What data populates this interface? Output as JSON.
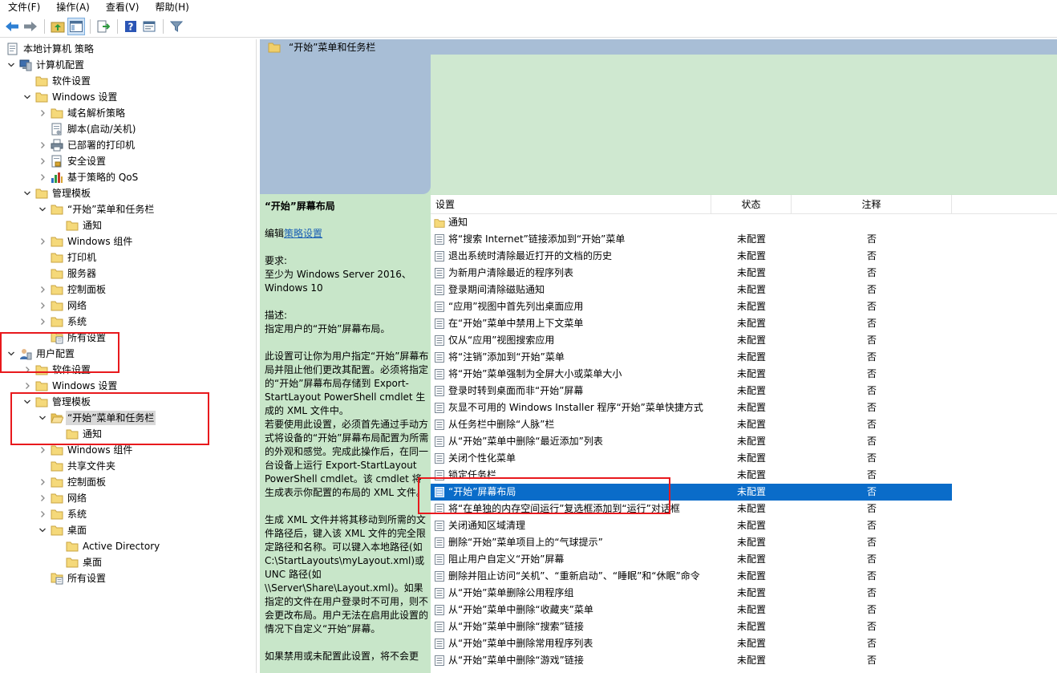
{
  "menu": [
    "文件(F)",
    "操作(A)",
    "查看(V)",
    "帮助(H)"
  ],
  "tree": [
    {
      "label": "本地计算机 策略",
      "level": 0,
      "exp": "",
      "icon": "policy-doc-icon"
    },
    {
      "label": "计算机配置",
      "level": 0,
      "exp": "open",
      "icon": "computer-icon"
    },
    {
      "label": "软件设置",
      "level": 1,
      "exp": "",
      "icon": "folder-icon"
    },
    {
      "label": "Windows 设置",
      "level": 1,
      "exp": "open",
      "icon": "folder-icon"
    },
    {
      "label": "域名解析策略",
      "level": 2,
      "exp": "closed",
      "icon": "folder-icon"
    },
    {
      "label": "脚本(启动/关机)",
      "level": 2,
      "exp": "",
      "icon": "script-icon"
    },
    {
      "label": "已部署的打印机",
      "level": 2,
      "exp": "closed",
      "icon": "printer-icon"
    },
    {
      "label": "安全设置",
      "level": 2,
      "exp": "closed",
      "icon": "security-icon"
    },
    {
      "label": "基于策略的 QoS",
      "level": 2,
      "exp": "closed",
      "icon": "qos-chart-icon"
    },
    {
      "label": "管理模板",
      "level": 1,
      "exp": "open",
      "icon": "folder-icon"
    },
    {
      "label": "“开始”菜单和任务栏",
      "level": 2,
      "exp": "open",
      "icon": "folder-icon"
    },
    {
      "label": "通知",
      "level": 3,
      "exp": "",
      "icon": "folder-icon"
    },
    {
      "label": "Windows 组件",
      "level": 2,
      "exp": "closed",
      "icon": "folder-icon"
    },
    {
      "label": "打印机",
      "level": 2,
      "exp": "",
      "icon": "folder-icon"
    },
    {
      "label": "服务器",
      "level": 2,
      "exp": "",
      "icon": "folder-icon"
    },
    {
      "label": "控制面板",
      "level": 2,
      "exp": "closed",
      "icon": "folder-icon"
    },
    {
      "label": "网络",
      "level": 2,
      "exp": "closed",
      "icon": "folder-icon"
    },
    {
      "label": "系统",
      "level": 2,
      "exp": "closed",
      "icon": "folder-icon"
    },
    {
      "label": "所有设置",
      "level": 2,
      "exp": "",
      "icon": "all-settings-icon"
    },
    {
      "label": "用户配置",
      "level": 0,
      "exp": "open",
      "icon": "user-icon"
    },
    {
      "label": "软件设置",
      "level": 1,
      "exp": "closed",
      "icon": "folder-icon"
    },
    {
      "label": "Windows 设置",
      "level": 1,
      "exp": "closed",
      "icon": "folder-icon"
    },
    {
      "label": "管理模板",
      "level": 1,
      "exp": "open",
      "icon": "folder-icon"
    },
    {
      "label": "“开始”菜单和任务栏",
      "level": 2,
      "exp": "open",
      "icon": "folder-open-icon",
      "selected": true
    },
    {
      "label": "通知",
      "level": 3,
      "exp": "",
      "icon": "folder-icon"
    },
    {
      "label": "Windows 组件",
      "level": 2,
      "exp": "closed",
      "icon": "folder-icon"
    },
    {
      "label": "共享文件夹",
      "level": 2,
      "exp": "",
      "icon": "folder-icon"
    },
    {
      "label": "控制面板",
      "level": 2,
      "exp": "closed",
      "icon": "folder-icon"
    },
    {
      "label": "网络",
      "level": 2,
      "exp": "closed",
      "icon": "folder-icon"
    },
    {
      "label": "系统",
      "level": 2,
      "exp": "closed",
      "icon": "folder-icon"
    },
    {
      "label": "桌面",
      "level": 2,
      "exp": "open",
      "icon": "folder-icon"
    },
    {
      "label": "Active Directory",
      "level": 3,
      "exp": "",
      "icon": "folder-icon"
    },
    {
      "label": "桌面",
      "level": 3,
      "exp": "",
      "icon": "folder-icon"
    },
    {
      "label": "所有设置",
      "level": 2,
      "exp": "",
      "icon": "all-settings-icon"
    }
  ],
  "right": {
    "header_title": "“开始”菜单和任务栏",
    "desc": {
      "title": "“开始”屏幕布局",
      "edit_prefix": "编辑",
      "edit_link": "策略设置",
      "req_label": "要求:",
      "req_text": "至少为 Windows Server 2016、Windows 10",
      "desc_label": "描述:",
      "desc_text": "指定用户的“开始”屏幕布局。",
      "p1": "此设置可让你为用户指定“开始”屏幕布局并阻止他们更改其配置。必须将指定的“开始”屏幕布局存储到 Export-StartLayout PowerShell cmdlet 生成的 XML 文件中。",
      "p2": "若要使用此设置，必须首先通过手动方式将设备的“开始”屏幕布局配置为所需的外观和感觉。完成此操作后，在同一台设备上运行 Export-StartLayout PowerShell cmdlet。该 cmdlet 将生成表示你配置的布局的 XML 文件。",
      "p3": "生成 XML 文件并将其移动到所需的文件路径后，键入该 XML 文件的完全限定路径和名称。可以键入本地路径(如 C:\\StartLayouts\\myLayout.xml)或 UNC 路径(如 \\\\Server\\Share\\Layout.xml)。如果指定的文件在用户登录时不可用，则不会更改布局。用户无法在启用此设置的情况下自定义“开始”屏幕。",
      "p4": "如果禁用或未配置此设置，将不会更"
    },
    "columns": {
      "setting": "设置",
      "state": "状态",
      "note": "注释"
    },
    "folder_row": "通知",
    "rows": [
      {
        "name": "将“搜索 Internet”链接添加到“开始”菜单",
        "state": "未配置",
        "note": "否"
      },
      {
        "name": "退出系统时清除最近打开的文档的历史",
        "state": "未配置",
        "note": "否"
      },
      {
        "name": "为新用户清除最近的程序列表",
        "state": "未配置",
        "note": "否"
      },
      {
        "name": "登录期间清除磁贴通知",
        "state": "未配置",
        "note": "否"
      },
      {
        "name": "“应用”视图中首先列出桌面应用",
        "state": "未配置",
        "note": "否"
      },
      {
        "name": "在“开始”菜单中禁用上下文菜单",
        "state": "未配置",
        "note": "否"
      },
      {
        "name": "仅从“应用”视图搜索应用",
        "state": "未配置",
        "note": "否"
      },
      {
        "name": "将“注销”添加到“开始”菜单",
        "state": "未配置",
        "note": "否"
      },
      {
        "name": "将“开始”菜单强制为全屏大小或菜单大小",
        "state": "未配置",
        "note": "否"
      },
      {
        "name": "登录时转到桌面而非“开始”屏幕",
        "state": "未配置",
        "note": "否"
      },
      {
        "name": "灰显不可用的 Windows Installer 程序“开始”菜单快捷方式",
        "state": "未配置",
        "note": "否"
      },
      {
        "name": "从任务栏中删除“人脉”栏",
        "state": "未配置",
        "note": "否"
      },
      {
        "name": "从“开始”菜单中删除“最近添加”列表",
        "state": "未配置",
        "note": "否"
      },
      {
        "name": "关闭个性化菜单",
        "state": "未配置",
        "note": "否"
      },
      {
        "name": "锁定任务栏",
        "state": "未配置",
        "note": "否"
      },
      {
        "name": "“开始”屏幕布局",
        "state": "未配置",
        "note": "否",
        "selected": true
      },
      {
        "name": "将“在单独的内存空间运行”复选框添加到“运行”对话框",
        "state": "未配置",
        "note": "否"
      },
      {
        "name": "关闭通知区域清理",
        "state": "未配置",
        "note": "否"
      },
      {
        "name": "删除“开始”菜单项目上的“气球提示”",
        "state": "未配置",
        "note": "否"
      },
      {
        "name": "阻止用户自定义“开始”屏幕",
        "state": "未配置",
        "note": "否"
      },
      {
        "name": "删除并阻止访问“关机”、“重新启动”、“睡眠”和“休眠”命令",
        "state": "未配置",
        "note": "否"
      },
      {
        "name": "从“开始”菜单删除公用程序组",
        "state": "未配置",
        "note": "否"
      },
      {
        "name": "从“开始”菜单中删除“收藏夹”菜单",
        "state": "未配置",
        "note": "否"
      },
      {
        "name": "从“开始”菜单中删除“搜索”链接",
        "state": "未配置",
        "note": "否"
      },
      {
        "name": "从“开始”菜单中删除常用程序列表",
        "state": "未配置",
        "note": "否"
      },
      {
        "name": "从“开始”菜单中删除“游戏”链接",
        "state": "未配置",
        "note": "否"
      }
    ]
  },
  "colors": {
    "selection": "#0a6cc9",
    "highlight_box": "#e8191d",
    "header_blue": "#a8bed6",
    "pane_green": "#c8e6c9"
  }
}
